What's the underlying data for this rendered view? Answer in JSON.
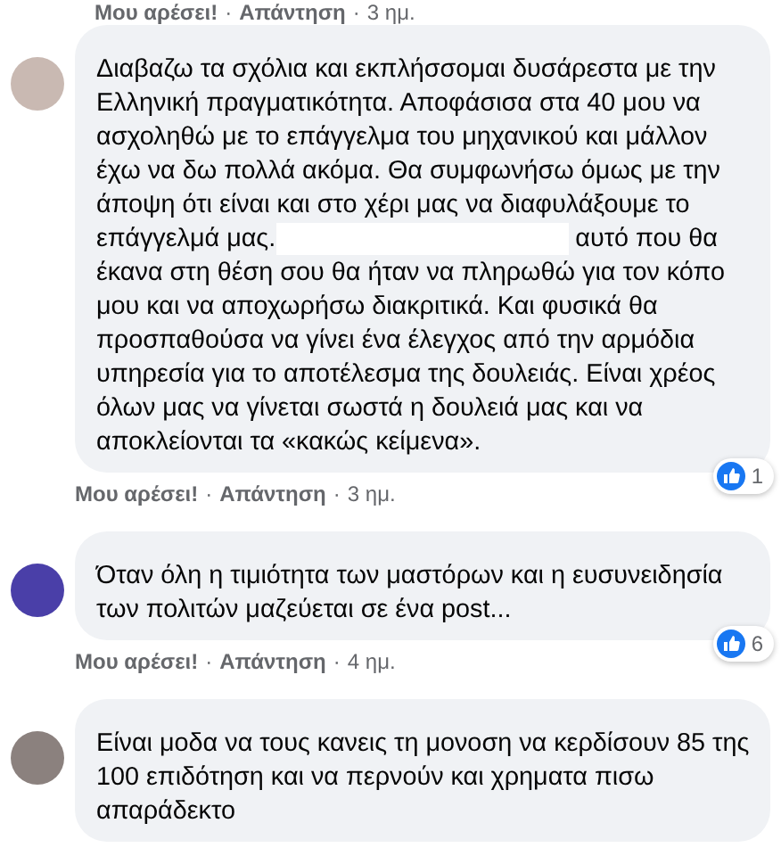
{
  "previous_comment_actions": [
    {
      "kind": "link",
      "label": "Μου αρέσει!"
    },
    {
      "kind": "separator",
      "label": "·"
    },
    {
      "kind": "link",
      "label": "Απάντηση"
    },
    {
      "kind": "separator",
      "label": "·"
    },
    {
      "kind": "time",
      "label": "3 ημ."
    }
  ],
  "comments": [
    {
      "text": "Διαβαζω τα σχόλια και εκπλήσσομαι δυσάρεστα με την Ελληνική πραγματικότητα. Αποφάσισα στα 40 μου να ασχοληθώ με το επάγγελμα του μηχανικού και μάλλον έχω να δω πολλά ακόμα. Θα συμφωνήσω όμως με την άποψη ότι είναι και στο χέρι μας να διαφυλάξουμε το επάγγελμά μας.",
      "text_continued": "αυτό που θα έκανα στη θέση σου θα ήταν να πληρωθώ για τον κόπο μου και να αποχωρήσω διακριτικά. Και φυσικά θα προσπαθούσα να γίνει ένα έλεγχος από την αρμόδια υπηρεσία για το αποτέλεσμα της δουλειάς. Είναι χρέος όλων μας να γίνεται σωστά η δουλειά μας και να αποκλείονται τα «κακώς κείμενα».",
      "reactions": "1",
      "actions": [
        {
          "kind": "link",
          "label": "Μου αρέσει!"
        },
        {
          "kind": "separator",
          "label": "·"
        },
        {
          "kind": "link",
          "label": "Απάντηση"
        },
        {
          "kind": "separator",
          "label": "·"
        },
        {
          "kind": "time",
          "label": "3 ημ."
        }
      ]
    },
    {
      "text": "Όταν όλη η τιμιότητα των μαστόρων και η ευσυνειδησία των πολιτών μαζεύεται σε ένα post...",
      "reactions": "6",
      "actions": [
        {
          "kind": "link",
          "label": "Μου αρέσει!"
        },
        {
          "kind": "separator",
          "label": "·"
        },
        {
          "kind": "link",
          "label": "Απάντηση"
        },
        {
          "kind": "separator",
          "label": "·"
        },
        {
          "kind": "time",
          "label": "4 ημ."
        }
      ]
    },
    {
      "text": "Είναι μοδα να τους κανεις τη μονοση να κερδίσουν 85 της 100 επιδότηση και να περνούν και χρηματα πισω απαράδεκτο"
    }
  ]
}
